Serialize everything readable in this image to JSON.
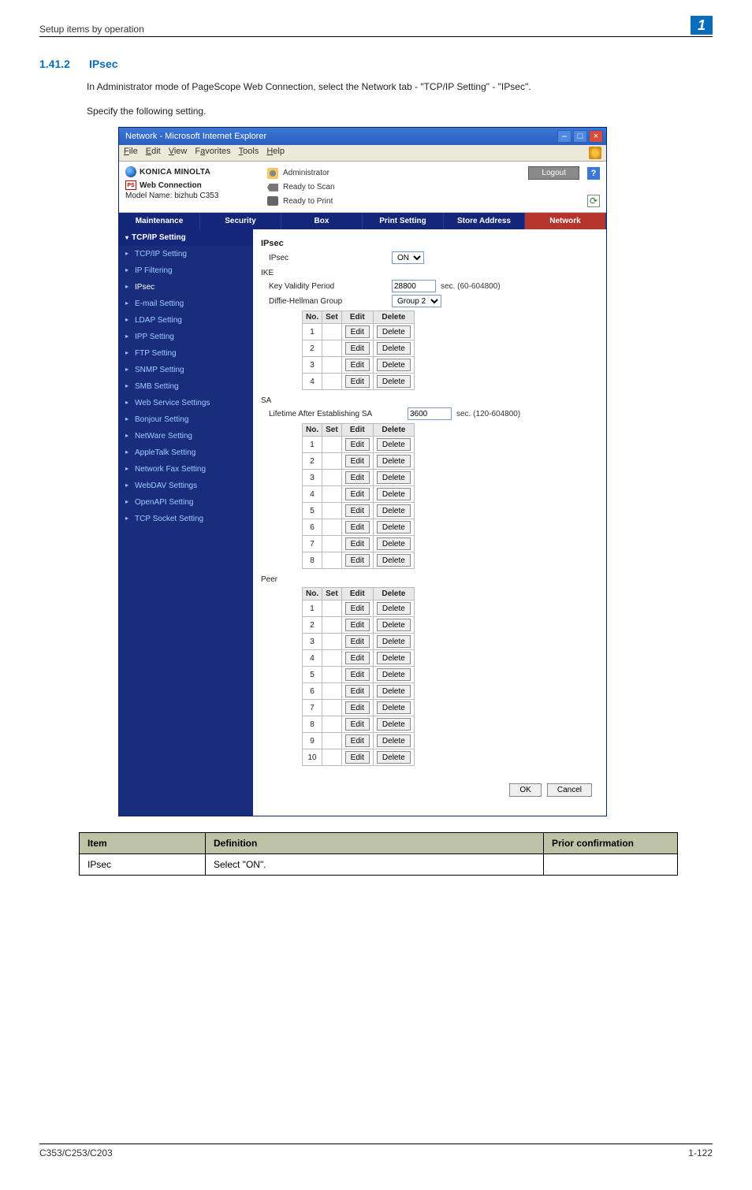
{
  "header": {
    "breadcrumb": "Setup items by operation",
    "badge": "1"
  },
  "section": {
    "number": "1.41.2",
    "title": "IPsec"
  },
  "body": {
    "p1": "In Administrator mode of PageScope Web Connection, select the Network tab - \"TCP/IP Setting\" - \"IPsec\".",
    "p2": "Specify the following setting."
  },
  "ie": {
    "title": "Network - Microsoft Internet Explorer",
    "menu": {
      "file": "File",
      "edit": "Edit",
      "view": "View",
      "favorites": "Favorites",
      "tools": "Tools",
      "help": "Help"
    }
  },
  "brand": {
    "km": "KONICA MINOLTA",
    "ps": "PAGE SCOPE",
    "wc": "Web Connection",
    "model_label": "Model Name:",
    "model_value": "bizhub C353"
  },
  "topright": {
    "admin": "Administrator",
    "logout": "Logout",
    "help": "?",
    "ready_scan": "Ready to Scan",
    "ready_print": "Ready to Print"
  },
  "tabs": {
    "maintenance": "Maintenance",
    "security": "Security",
    "box": "Box",
    "print": "Print Setting",
    "store": "Store Address",
    "network": "Network"
  },
  "sidebar": {
    "group": "TCP/IP Setting",
    "items": [
      "TCP/IP Setting",
      "IP Filtering",
      "IPsec",
      "E-mail Setting",
      "LDAP Setting",
      "IPP Setting",
      "FTP Setting",
      "SNMP Setting",
      "SMB Setting",
      "Web Service Settings",
      "Bonjour Setting",
      "NetWare Setting",
      "AppleTalk Setting",
      "Network Fax Setting",
      "WebDAV Settings",
      "OpenAPI Setting",
      "TCP Socket Setting"
    ],
    "active_index": 2
  },
  "content": {
    "ipsec_heading": "IPsec",
    "ipsec_label": "IPsec",
    "ipsec_value": "ON",
    "ike_heading": "IKE",
    "kvp_label": "Key Validity Period",
    "kvp_value": "28800",
    "kvp_unit": "sec. (60-604800)",
    "dh_label": "Diffie-Hellman Group",
    "dh_value": "Group 2",
    "table_headers": {
      "no": "No.",
      "set": "Set",
      "edit": "Edit",
      "delete": "Delete"
    },
    "edit_btn": "Edit",
    "delete_btn": "Delete",
    "ike_rows": [
      "1",
      "2",
      "3",
      "4"
    ],
    "sa_heading": "SA",
    "sa_label": "Lifetime After Establishing SA",
    "sa_value": "3600",
    "sa_unit": "sec. (120-604800)",
    "sa_rows": [
      "1",
      "2",
      "3",
      "4",
      "5",
      "6",
      "7",
      "8"
    ],
    "peer_heading": "Peer",
    "peer_rows": [
      "1",
      "2",
      "3",
      "4",
      "5",
      "6",
      "7",
      "8",
      "9",
      "10"
    ],
    "ok": "OK",
    "cancel": "Cancel"
  },
  "def_table": {
    "h_item": "Item",
    "h_def": "Definition",
    "h_prior": "Prior confirmation",
    "r_item": "IPsec",
    "r_def": "Select \"ON\".",
    "r_prior": ""
  },
  "footer": {
    "left": "C353/C253/C203",
    "right": "1-122"
  }
}
